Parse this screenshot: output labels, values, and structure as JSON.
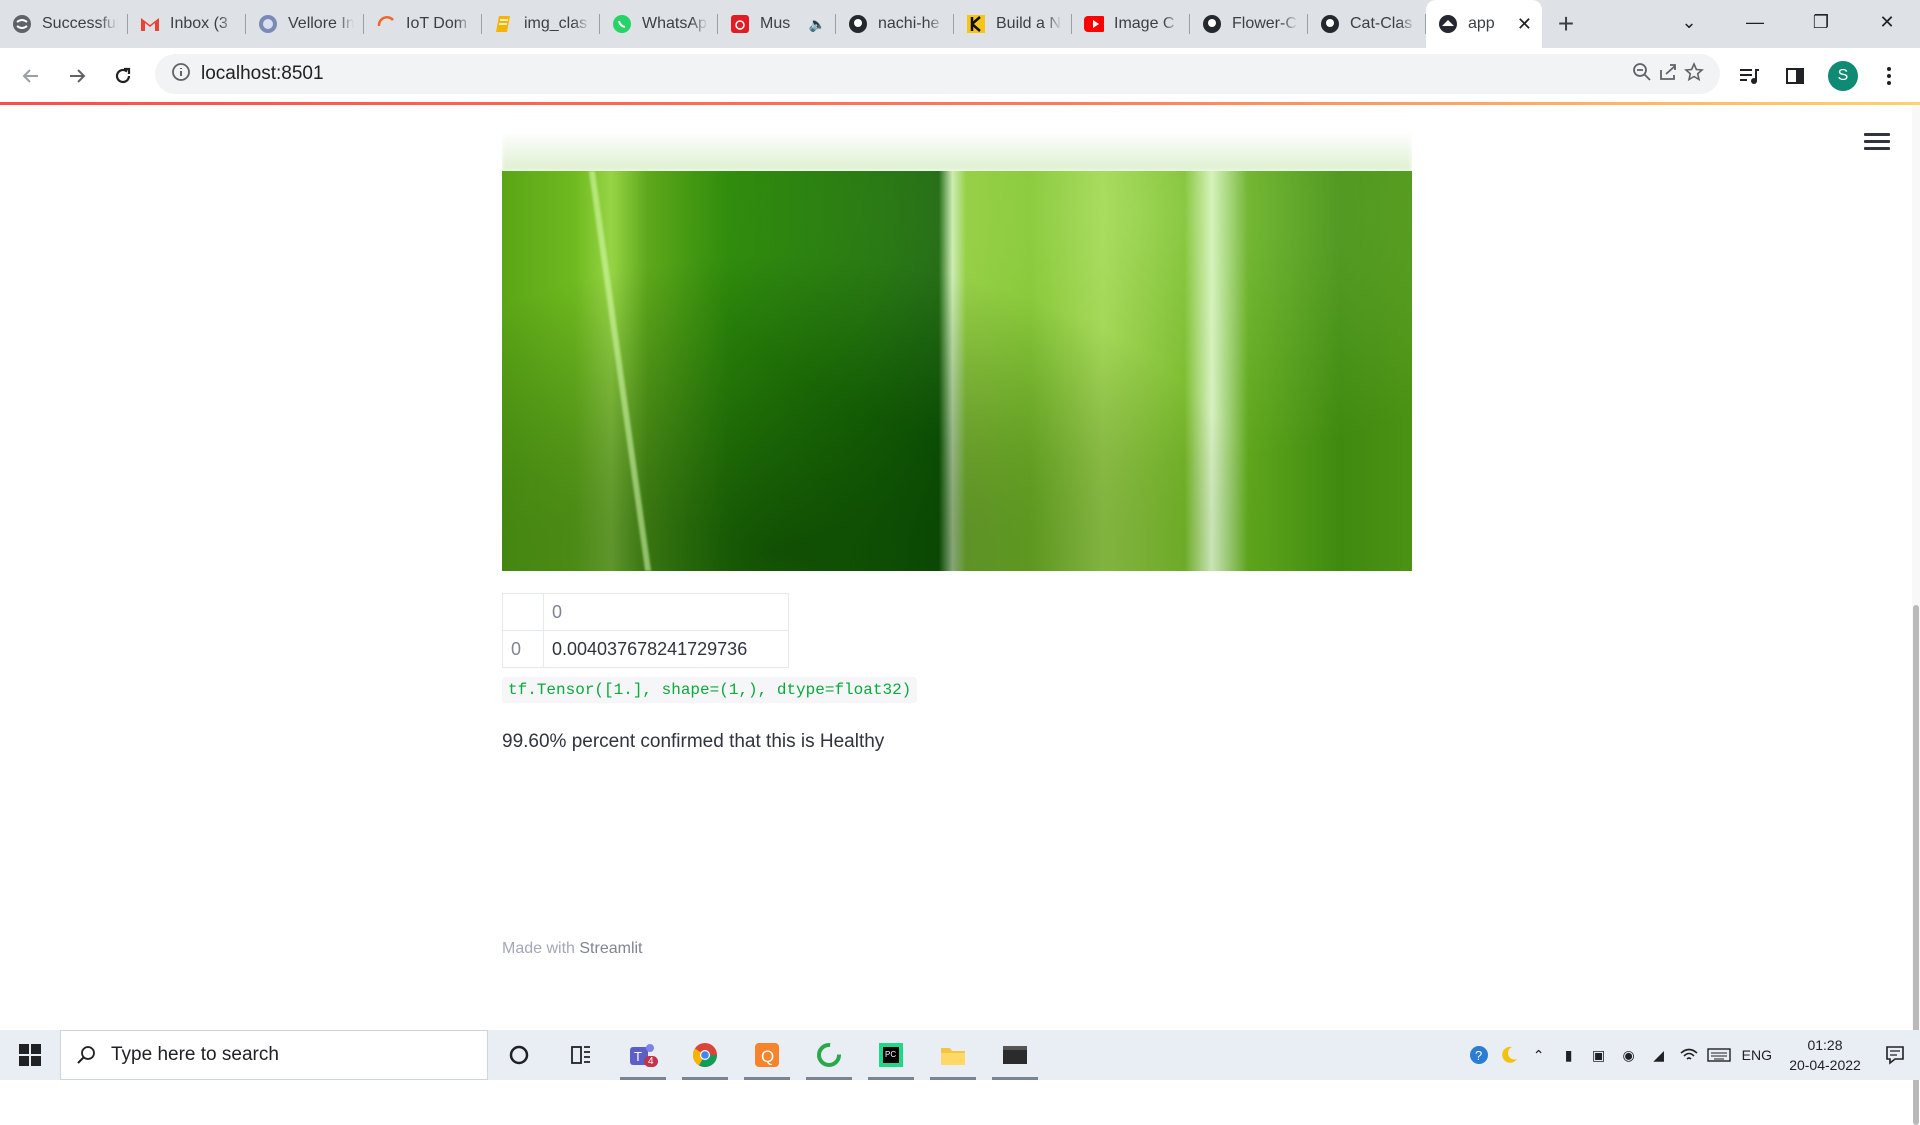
{
  "browser": {
    "tabs": [
      {
        "title": "Successfully",
        "icon": "tab-favicon-icon"
      },
      {
        "title": "Inbox (3",
        "icon": "gmail-icon"
      },
      {
        "title": "Vellore In",
        "icon": "university-icon"
      },
      {
        "title": "IoT Dom",
        "icon": "loading-icon"
      },
      {
        "title": "img_clas",
        "icon": "notebook-icon"
      },
      {
        "title": "WhatsAp",
        "icon": "whatsapp-icon"
      },
      {
        "title": "Mus",
        "icon": "music-icon"
      },
      {
        "title": "nachi-he",
        "icon": "github-icon"
      },
      {
        "title": "Build a N",
        "icon": "kaggle-icon"
      },
      {
        "title": "Image C",
        "icon": "youtube-icon"
      },
      {
        "title": "Flower-C",
        "icon": "github-icon"
      },
      {
        "title": "Cat-Clas",
        "icon": "github-icon"
      },
      {
        "title": "app",
        "icon": "streamlit-icon"
      }
    ],
    "url": "localhost:8501",
    "profile_initial": "S"
  },
  "app": {
    "table": {
      "column_header": "0",
      "row_index": "0",
      "value": "0.004037678241729736"
    },
    "tensor_output": "tf.Tensor([1.], shape=(1,), dtype=float32)",
    "result": "99.60% percent confirmed that this is Healthy",
    "footer_prefix": "Made with",
    "footer_brand": "Streamlit"
  },
  "taskbar": {
    "search_placeholder": "Type here to search",
    "lang": "ENG",
    "time": "01:28",
    "date": "20-04-2022",
    "teams_badge": "4"
  }
}
